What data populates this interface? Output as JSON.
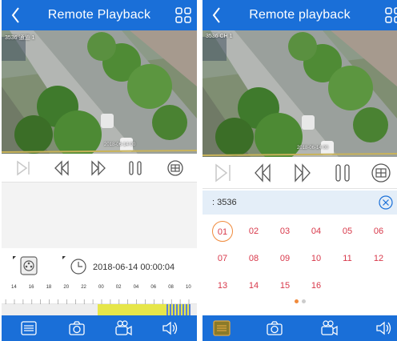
{
  "left_screen": {
    "title": "Remote Playback",
    "osd_text": "3536 通道 1",
    "video_timestamp": "2018-06-14 00",
    "timeline_date": "2018-06-14 00:00:04",
    "ruler_labels": [
      "14",
      "16",
      "18",
      "20",
      "22",
      "00",
      "02",
      "04",
      "06",
      "08",
      "10"
    ]
  },
  "right_screen": {
    "title": "Remote playback",
    "osd_text": "3536 CH 1",
    "video_timestamp": "2018-06-14 00",
    "device_name": "3536",
    "device_prefix": ":",
    "selected_day": "01",
    "days": [
      "01",
      "02",
      "03",
      "04",
      "05",
      "06",
      "07",
      "08",
      "09",
      "10",
      "11",
      "12",
      "13",
      "14",
      "15",
      "16"
    ],
    "page_count": 2,
    "current_page": 1
  },
  "colors": {
    "accent_blue": "#1a6fd8",
    "day_red": "#d8384a",
    "selected_ring": "#f08a3c",
    "timeline_yellow": "#e6e64a",
    "timeline_blue": "#5b7fd6"
  },
  "icons": {
    "back": "chevron-left-icon",
    "view_grid": "grid-icon",
    "step": "step-icon",
    "rewind": "rewind-icon",
    "fast_forward": "fast-forward-icon",
    "pause": "pause-icon",
    "window_split": "window-split-icon",
    "record_type": "film-reel-icon",
    "clock": "clock-icon",
    "file_list": "file-list-icon",
    "snapshot": "camera-icon",
    "record": "video-camera-icon",
    "audio": "speaker-icon",
    "clear": "close-circle-icon"
  }
}
